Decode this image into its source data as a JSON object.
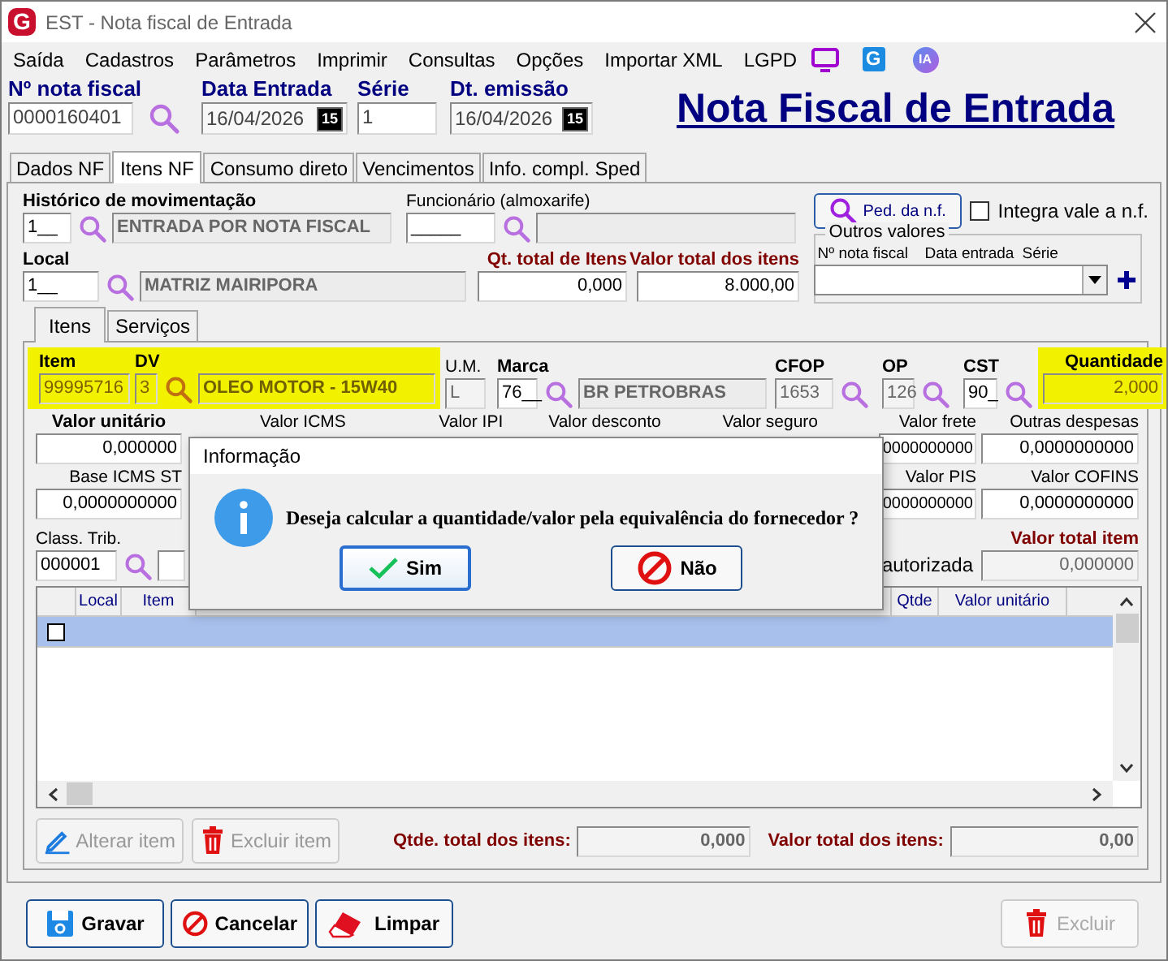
{
  "window": {
    "title": "EST - Nota fiscal de Entrada",
    "logo": "G"
  },
  "menu": [
    {
      "label": "Saída"
    },
    {
      "label": "Cadastros"
    },
    {
      "label": "Parâmetros"
    },
    {
      "label": "Imprimir"
    },
    {
      "label": "Consultas"
    },
    {
      "label": "Opções"
    },
    {
      "label": "Importar XML"
    },
    {
      "label": "LGPD"
    }
  ],
  "menu_badges": [
    {
      "text": "G",
      "kind": "app"
    },
    {
      "text": "IA",
      "kind": "ai"
    }
  ],
  "header": {
    "fields": [
      {
        "label": "Nº nota fiscal",
        "value": "0000160401"
      },
      {
        "label": "Data Entrada",
        "value": "16/04/2026",
        "calendar": "15"
      },
      {
        "label": "Série",
        "value": "1"
      },
      {
        "label": "Dt. emissão",
        "value": "16/04/2026",
        "calendar": "15"
      }
    ],
    "title": "Nota Fiscal de Entrada"
  },
  "tabs": [
    {
      "label": "Dados NF",
      "selected": false
    },
    {
      "label": "Itens NF",
      "selected": true
    },
    {
      "label": "Consumo direto",
      "selected": false
    },
    {
      "label": "Vencimentos",
      "selected": false
    },
    {
      "label": "Info. compl. Sped",
      "selected": false
    }
  ],
  "movement": {
    "history_label": "Histórico de movimentação",
    "history_code": "1__",
    "history_name": "ENTRADA POR NOTA FISCAL",
    "employee_label": "Funcionário (almoxarife)",
    "employee_code": "_____",
    "local_label": "Local",
    "local_code": "1__",
    "local_name": "MATRIZ MAIRIPORA",
    "qty_label": "Qt. total de Itens",
    "qty_value": "0,000",
    "total_label": "Valor total dos itens",
    "total_value": "8.000,00",
    "order_button": "Ped. da n.f.",
    "integrate": {
      "label": "Integra vale a n.f.",
      "checked": false
    },
    "other": {
      "title": "Outros valores",
      "columns": [
        "Nº nota fiscal",
        "Data entrada",
        "Série"
      ]
    }
  },
  "subtabs": [
    {
      "label": "Itens",
      "selected": true
    },
    {
      "label": "Serviços",
      "selected": false
    }
  ],
  "item": {
    "item_label": "Item",
    "item_code": "99995716",
    "dv_label": "DV",
    "dv": "3",
    "description": "OLEO MOTOR - 15W40",
    "um_label": "U.M.",
    "um": "L",
    "brand_label": "Marca",
    "brand_code": "76__",
    "brand_name": "BR PETROBRAS",
    "cfop_label": "CFOP",
    "cfop": "1653",
    "op_label": "OP",
    "op": "126",
    "cst_label": "CST",
    "cst": "90_",
    "qty_label": "Quantidade",
    "qty": "2,000"
  },
  "values": {
    "unit_label": "Valor unitário",
    "unit": "0,000000",
    "icms_label": "Valor ICMS",
    "ipi_label": "Valor IPI",
    "discount_label": "Valor desconto",
    "insurance_label": "Valor seguro",
    "freight_label": "Valor frete",
    "freight": "0000000000",
    "other_label": "Outras despesas",
    "other": "0,0000000000",
    "base_st_label": "Base ICMS ST",
    "base_st": "0,0000000000",
    "pis_label": "Valor PIS",
    "pis": "0000000000",
    "cofins_label": "Valor COFINS",
    "cofins": "0,0000000000",
    "class_label": "Class. Trib.",
    "class_code": "000001",
    "authorized_label": "autorizada",
    "total_item_label": "Valor total item",
    "total_item": "0,000000"
  },
  "grid": {
    "columns": [
      "Local",
      "Item",
      "Qtde",
      "Valor unitário"
    ],
    "rows": [
      {
        "selected": true,
        "checked": false
      }
    ]
  },
  "item_buttons": [
    {
      "label": "Alterar item",
      "kind": "edit",
      "disabled": true
    },
    {
      "label": "Excluir item",
      "kind": "delete",
      "disabled": true
    }
  ],
  "totals": {
    "qty_label": "Qtde. total dos itens:",
    "qty": "0,000",
    "value_label": "Valor total dos itens:",
    "value": "0,00"
  },
  "buttons": [
    {
      "label": "Gravar",
      "kind": "save",
      "disabled": false
    },
    {
      "label": "Cancelar",
      "kind": "cancel",
      "disabled": false
    },
    {
      "label": "Limpar",
      "kind": "clear",
      "disabled": false
    },
    {
      "label": "Excluir",
      "kind": "delete",
      "disabled": true
    }
  ],
  "dialog": {
    "title": "Informação",
    "message": "Deseja calcular a quantidade/valor pela equivalência do fornecedor ?",
    "buttons": [
      {
        "label": "Sim",
        "kind": "yes",
        "selected": true
      },
      {
        "label": "Não",
        "kind": "no",
        "selected": false
      }
    ]
  }
}
